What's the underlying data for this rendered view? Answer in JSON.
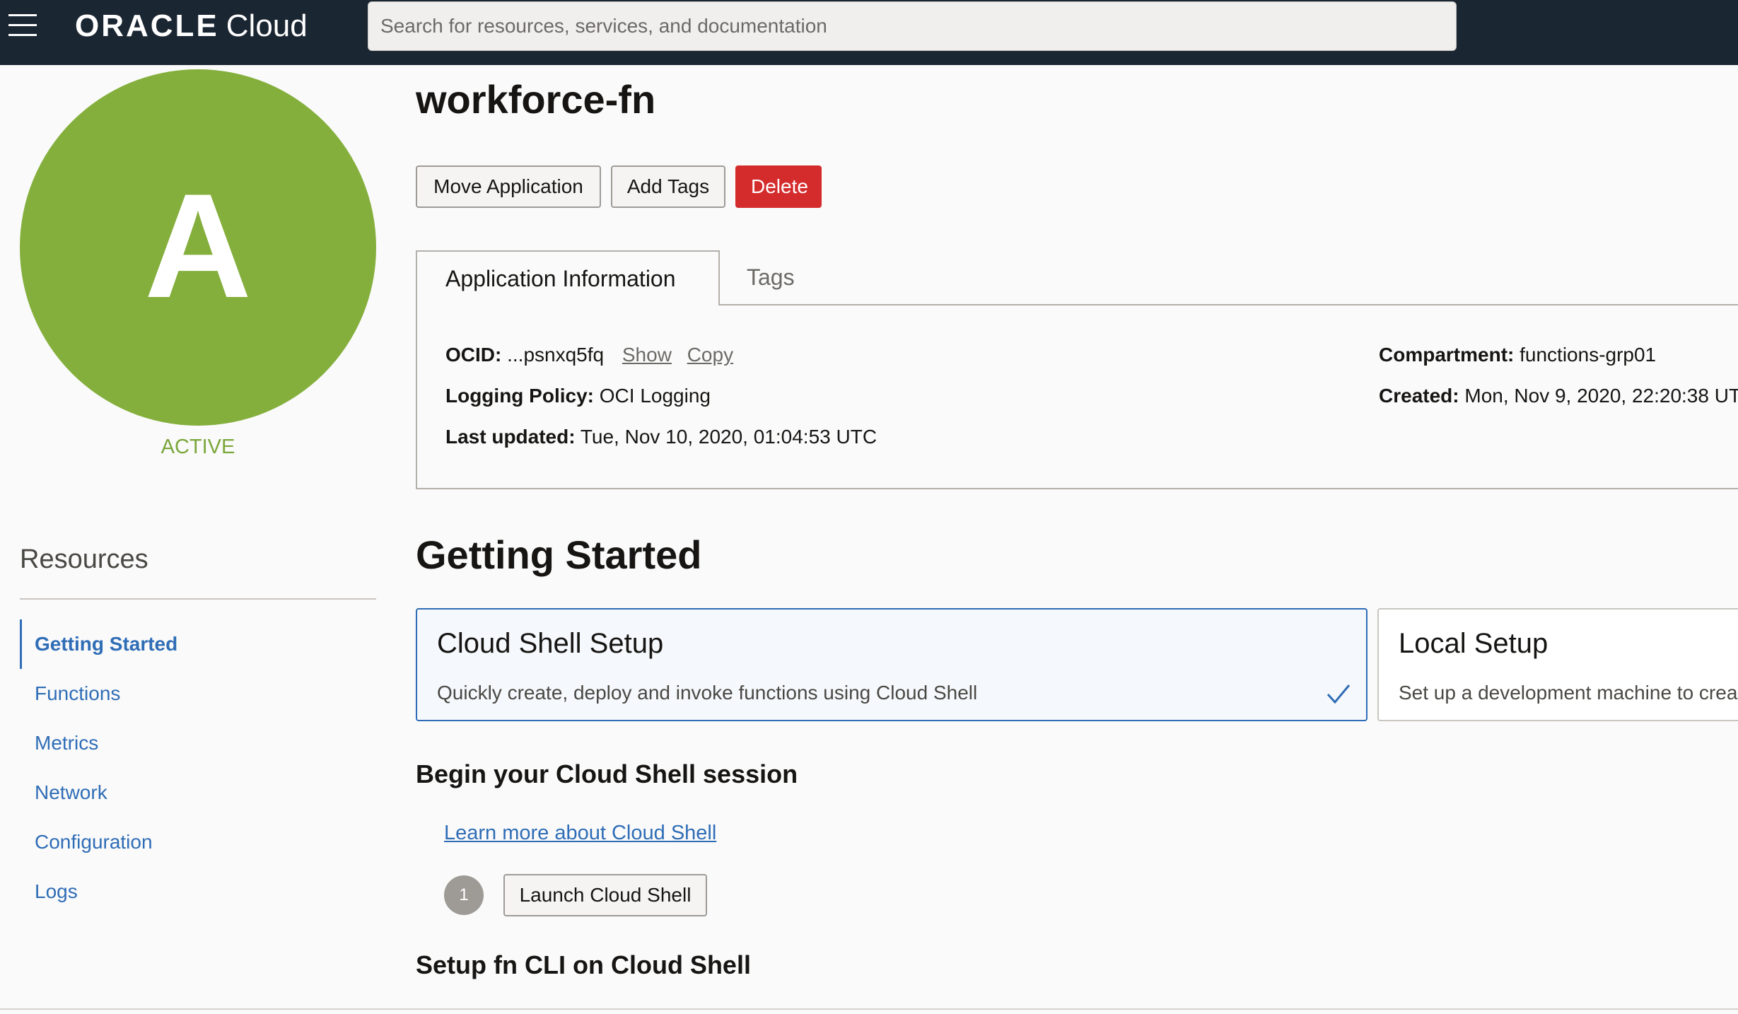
{
  "header": {
    "brand_oracle": "ORACLE",
    "brand_cloud": "Cloud",
    "search_placeholder": "Search for resources, services, and documentation"
  },
  "resource": {
    "avatar_letter": "A",
    "status": "ACTIVE",
    "avatar_color": "#84af3c"
  },
  "page": {
    "title": "workforce-fn",
    "buttons": {
      "move": "Move Application",
      "add_tags": "Add Tags",
      "delete": "Delete"
    },
    "tabs": [
      "Application Information",
      "Tags"
    ]
  },
  "info": {
    "ocid_label": "OCID:",
    "ocid_value": "...psnxq5fq",
    "show": "Show",
    "copy": "Copy",
    "logging_label": "Logging Policy:",
    "logging_value": "OCI Logging",
    "updated_label": "Last updated:",
    "updated_value": "Tue, Nov 10, 2020, 01:04:53 UTC",
    "compartment_label": "Compartment:",
    "compartment_value": "functions-grp01",
    "created_label": "Created:",
    "created_value": "Mon, Nov 9, 2020, 22:20:38 UT"
  },
  "sidebar": {
    "title": "Resources",
    "items": [
      "Getting Started",
      "Functions",
      "Metrics",
      "Network",
      "Configuration",
      "Logs"
    ],
    "active_index": 0
  },
  "getting_started": {
    "title": "Getting Started",
    "cards": [
      {
        "title": "Cloud Shell Setup",
        "description": "Quickly create, deploy and invoke functions using Cloud Shell",
        "selected": true
      },
      {
        "title": "Local Setup",
        "description": "Set up a development machine to crea",
        "selected": false
      }
    ],
    "session_heading": "Begin your Cloud Shell session",
    "learn_link": "Learn more about Cloud Shell",
    "step_number": "1",
    "launch_button": "Launch Cloud Shell",
    "setup_heading": "Setup fn CLI on Cloud Shell"
  },
  "colors": {
    "topbar": "#1b2633",
    "link": "#2f6db6",
    "delete": "#d42c2c",
    "active_status": "#7aa63a"
  },
  "icons": [
    "hamburger-menu-icon",
    "check-icon"
  ]
}
